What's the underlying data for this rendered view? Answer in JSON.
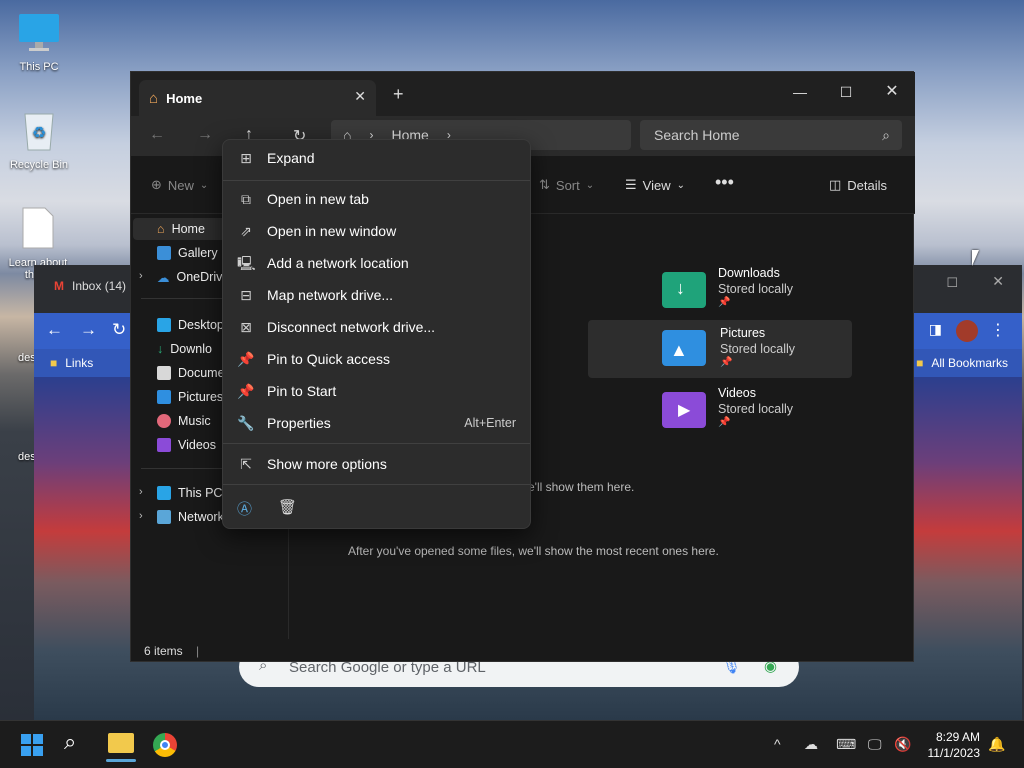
{
  "desktop": {
    "icons": [
      {
        "label": "This PC"
      },
      {
        "label": "Recycle Bin"
      },
      {
        "label": "Learn about this p"
      }
    ],
    "partial_labels": [
      "des",
      "des"
    ]
  },
  "chrome": {
    "tab_label": "Inbox (14)",
    "bookmarks": {
      "left": "Links",
      "right": "All Bookmarks"
    },
    "search_placeholder": "Search Google or type a URL"
  },
  "explorer": {
    "tab_title": "Home",
    "address": {
      "segment": "Home"
    },
    "search_placeholder": "Search Home",
    "commands": {
      "new": "New",
      "sort": "Sort",
      "view": "View",
      "details": "Details"
    },
    "sidebar": {
      "top": [
        {
          "label": "Home"
        },
        {
          "label": "Gallery"
        },
        {
          "label": "OneDriv"
        }
      ],
      "quick": [
        {
          "label": "Desktop"
        },
        {
          "label": "Downlo"
        },
        {
          "label": "Docume"
        },
        {
          "label": "Pictures"
        },
        {
          "label": "Music"
        },
        {
          "label": "Videos"
        }
      ],
      "bottom": [
        {
          "label": "This PC"
        },
        {
          "label": "Network"
        }
      ]
    },
    "folders": [
      {
        "name": "Downloads",
        "status": "Stored locally",
        "color": "#1fa37a"
      },
      {
        "name": "Pictures",
        "status": "Stored locally",
        "color": "#2f8fe0"
      },
      {
        "name": "Videos",
        "status": "Stored locally",
        "color": "#8b4bd8"
      }
    ],
    "hint_partial": "e'll show them here.",
    "recent_hint": "After you've opened some files, we'll show the most recent ones here.",
    "status": "6 items"
  },
  "context_menu": {
    "items": [
      {
        "label": "Expand",
        "icon": "expand-icon"
      },
      {
        "label": "Open in new tab",
        "icon": "new-tab-icon"
      },
      {
        "label": "Open in new window",
        "icon": "new-window-icon"
      },
      {
        "label": "Add a network location",
        "icon": "network-location-icon"
      },
      {
        "label": "Map network drive...",
        "icon": "map-drive-icon"
      },
      {
        "label": "Disconnect network drive...",
        "icon": "disconnect-drive-icon"
      },
      {
        "label": "Pin to Quick access",
        "icon": "pin-icon"
      },
      {
        "label": "Pin to Start",
        "icon": "pin-icon"
      },
      {
        "label": "Properties",
        "icon": "wrench-icon",
        "accelerator": "Alt+Enter"
      },
      {
        "label": "Show more options",
        "icon": "more-options-icon"
      }
    ]
  },
  "taskbar": {
    "time": "8:29 AM",
    "date": "11/1/2023"
  },
  "colors": {
    "accent": "#0078d4",
    "menu_bg": "#2c2c2c",
    "explorer_bg": "#191919"
  }
}
